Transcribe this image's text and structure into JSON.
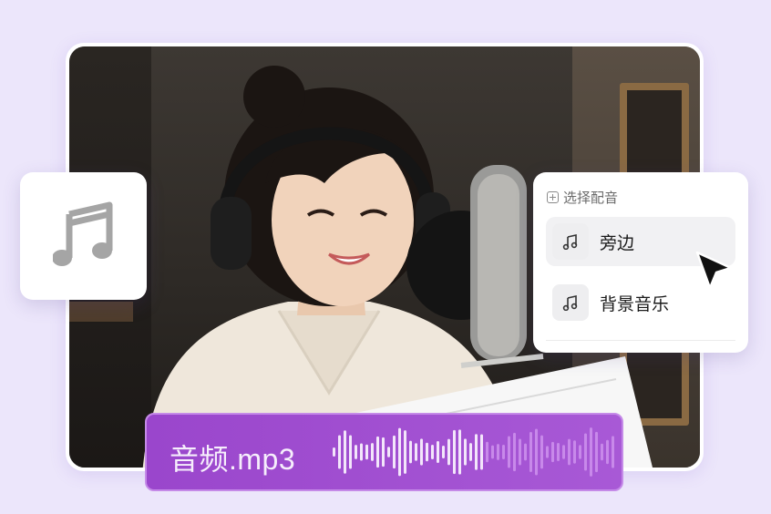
{
  "menu": {
    "title": "选择配音",
    "items": [
      {
        "label": "旁边",
        "icon": "music-note-icon",
        "hovered": true
      },
      {
        "label": "背景音乐",
        "icon": "music-note-icon",
        "hovered": false
      }
    ]
  },
  "audio": {
    "file_name": "音频.mp3",
    "icon": "waveform-icon"
  },
  "feature_card": {
    "icon": "music-note-icon"
  },
  "colors": {
    "background": "#ece6fb",
    "audio_bar": "#a152d2",
    "menu_hover": "#f1f1f3"
  }
}
